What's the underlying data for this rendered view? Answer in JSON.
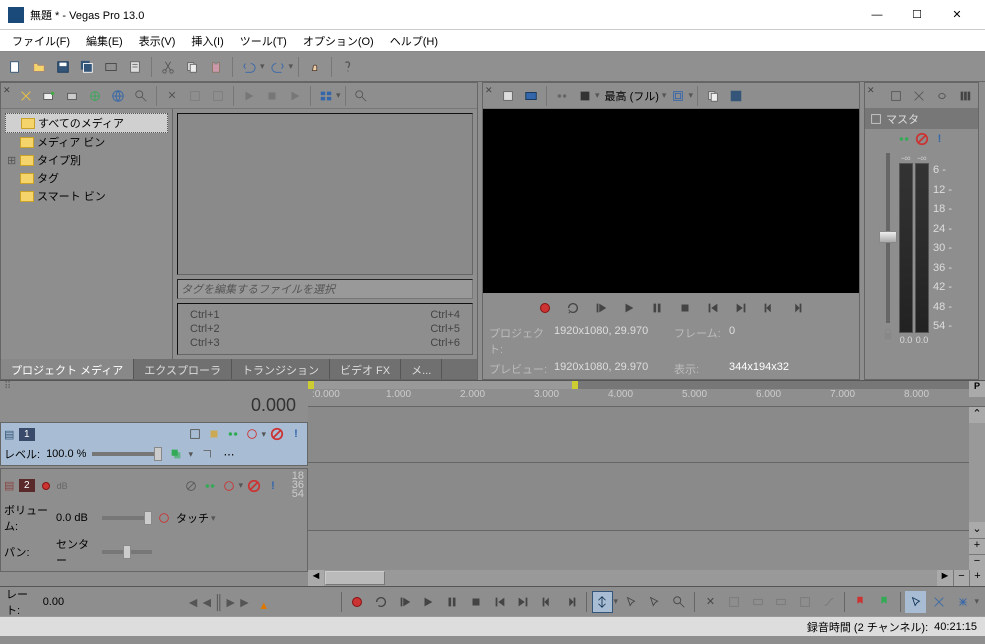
{
  "window": {
    "title": "無題 * - Vegas Pro 13.0"
  },
  "menu": {
    "file": "ファイル(F)",
    "edit": "編集(E)",
    "view": "表示(V)",
    "insert": "挿入(I)",
    "tools": "ツール(T)",
    "options": "オプション(O)",
    "help": "ヘルプ(H)"
  },
  "media_tree": {
    "all": "すべてのメディア",
    "bins": "メディア ビン",
    "bytype": "タイプ別",
    "tags": "タグ",
    "smart": "スマート ビン"
  },
  "tag_placeholder": "タグを編集するファイルを選択",
  "shortcuts": {
    "c1": "Ctrl+1",
    "c2": "Ctrl+2",
    "c3": "Ctrl+3",
    "c4": "Ctrl+4",
    "c5": "Ctrl+5",
    "c6": "Ctrl+6"
  },
  "tabs": {
    "project_media": "プロジェクト メディア",
    "explorer": "エクスプローラ",
    "transitions": "トランジション",
    "videofx": "ビデオ FX",
    "media_gen": "メ..."
  },
  "preview": {
    "quality": "最高 (フル)",
    "project_label": "プロジェクト:",
    "project_val": "1920x1080, 29.970",
    "frame_label": "フレーム:",
    "frame_val": "0",
    "preview_label": "プレビュー:",
    "preview_val": "1920x1080, 29.970",
    "display_label": "表示:",
    "display_val": "344x194x32"
  },
  "master": {
    "label": "マスタ",
    "scale": [
      "-∞",
      "6 -",
      "12 -",
      "18 -",
      "24 -",
      "30 -",
      "36 -",
      "42 -",
      "48 -",
      "54 -"
    ],
    "inf_l": "-∞",
    "inf_r": "-∞",
    "val_l": "0.0",
    "val_r": "0.0"
  },
  "timeline": {
    "time": "0.000",
    "ruler": [
      ":0.000",
      "1.000",
      "2.000",
      "3.000",
      "4.000",
      "5.000",
      "6.000",
      "7.000",
      "8.000"
    ]
  },
  "track1": {
    "num": "1",
    "level_label": "レベル:",
    "level_val": "100.0 %"
  },
  "track2": {
    "num": "2",
    "vol_label": "ボリューム:",
    "vol_val": "0.0 dB",
    "pan_label": "パン:",
    "pan_val": "センター",
    "touch": "タッチ",
    "meters": [
      "18",
      "36",
      "54"
    ]
  },
  "rate": {
    "label": "レート:",
    "val": "0.00"
  },
  "status": {
    "rec_label": "録音時間 (2 チャンネル):",
    "rec_val": "40:21:15"
  }
}
